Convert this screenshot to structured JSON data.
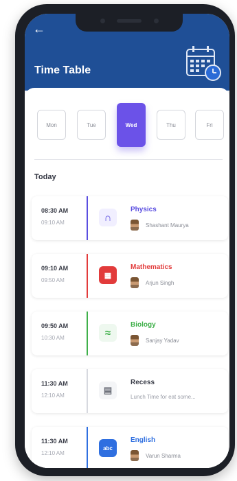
{
  "header": {
    "title": "Time Table"
  },
  "days": [
    "Mon",
    "Tue",
    "Wed",
    "Thu",
    "Fri"
  ],
  "active_day": "Wed",
  "section_label": "Today",
  "slots": [
    {
      "start": "08:30 AM",
      "end": "09:10 AM",
      "subject": "Physics",
      "teacher": "Shashant Maurya",
      "color": "#5a4ee0",
      "icon": "magnet-icon"
    },
    {
      "start": "09:10 AM",
      "end": "09:50 AM",
      "subject": "Mathematics",
      "teacher": "Arjun Singh",
      "color": "#e23b3b",
      "icon": "math-blocks-icon"
    },
    {
      "start": "09:50 AM",
      "end": "10:30 AM",
      "subject": "Biology",
      "teacher": "Sanjay Yadav",
      "color": "#3fb04a",
      "icon": "dna-icon"
    },
    {
      "start": "11:30 AM",
      "end": "12:10 AM",
      "subject": "Recess",
      "note": "Lunch Time for eat some...",
      "color": "#3a3d48",
      "icon": "lunch-icon"
    },
    {
      "start": "11:30 AM",
      "end": "12:10 AM",
      "subject": "English",
      "teacher": "Varun Sharma",
      "color": "#2f6fe0",
      "icon": "abc-book-icon"
    }
  ]
}
